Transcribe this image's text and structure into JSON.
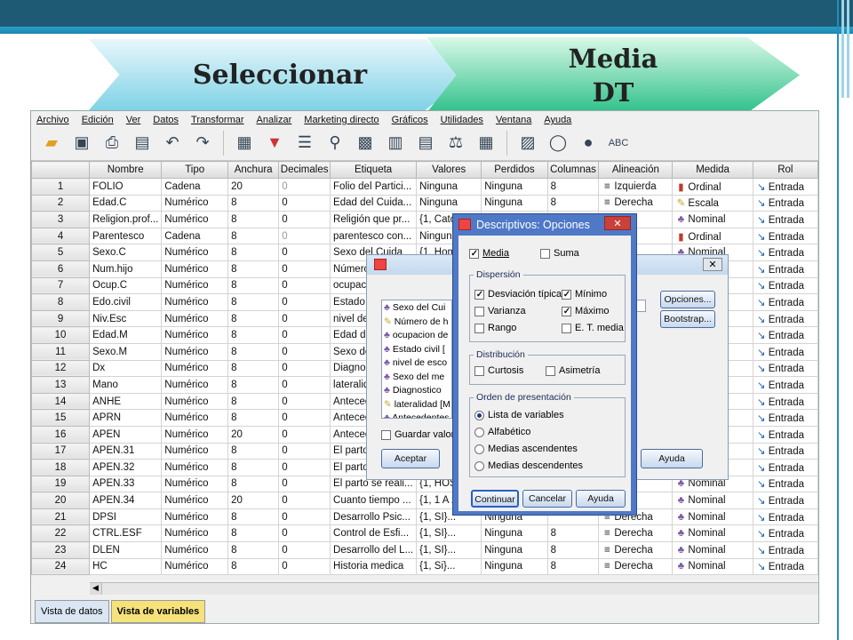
{
  "slide": {
    "step1": "Seleccionar",
    "step2_line1": "Media",
    "step2_line2": "DT"
  },
  "menu": [
    "Archivo",
    "Edición",
    "Ver",
    "Datos",
    "Transformar",
    "Analizar",
    "Marketing directo",
    "Gráficos",
    "Utilidades",
    "Ventana",
    "Ayuda"
  ],
  "grid": {
    "headers": [
      "",
      "Nombre",
      "Tipo",
      "Anchura",
      "Decimales",
      "Etiqueta",
      "Valores",
      "Perdidos",
      "Columnas",
      "Alineación",
      "Medida",
      "Rol"
    ],
    "rows": [
      [
        "1",
        "FOLIO",
        "Cadena",
        "20",
        "0",
        "Folio del Partici...",
        "Ninguna",
        "Ninguna",
        "8",
        "Izquierda",
        "Ordinal",
        "Entrada"
      ],
      [
        "2",
        "Edad.C",
        "Numérico",
        "8",
        "0",
        "Edad del Cuida...",
        "Ninguna",
        "Ninguna",
        "8",
        "Derecha",
        "Escala",
        "Entrada"
      ],
      [
        "3",
        "Religion.prof...",
        "Numérico",
        "8",
        "0",
        "Religión que pr...",
        "{1, Catolic",
        "",
        "",
        "a",
        "Nominal",
        "Entrada"
      ],
      [
        "4",
        "Parentesco",
        "Cadena",
        "8",
        "0",
        "parentesco con...",
        "Ninguna",
        "",
        "",
        "da",
        "Ordinal",
        "Entrada"
      ],
      [
        "5",
        "Sexo.C",
        "Numérico",
        "8",
        "0",
        "Sexo del Cuida",
        "{1, Homb",
        "",
        "",
        "a",
        "Nominal",
        "Entrada"
      ],
      [
        "6",
        "Num.hijo",
        "Numérico",
        "8",
        "0",
        "Número",
        "",
        "",
        "",
        "",
        "",
        "Entrada"
      ],
      [
        "7",
        "Ocup.C",
        "Numérico",
        "8",
        "0",
        "ocupacio",
        "",
        "",
        "",
        "",
        "",
        "Entrada"
      ],
      [
        "8",
        "Edo.civil",
        "Numérico",
        "8",
        "0",
        "Estado c",
        "",
        "",
        "",
        "",
        "",
        "Entrada"
      ],
      [
        "9",
        "Niv.Esc",
        "Numérico",
        "8",
        "0",
        "nivel de",
        "",
        "",
        "",
        "",
        "",
        "Entrada"
      ],
      [
        "10",
        "Edad.M",
        "Numérico",
        "8",
        "0",
        "Edad de",
        "",
        "",
        "",
        "",
        "",
        "Entrada"
      ],
      [
        "11",
        "Sexo.M",
        "Numérico",
        "8",
        "0",
        "Sexo de",
        "",
        "",
        "",
        "",
        "",
        "Entrada"
      ],
      [
        "12",
        "Dx",
        "Numérico",
        "8",
        "0",
        "Diagnost",
        "",
        "",
        "",
        "",
        "",
        "Entrada"
      ],
      [
        "13",
        "Mano",
        "Numérico",
        "8",
        "0",
        "lateralida",
        "",
        "",
        "",
        "",
        "",
        "Entrada"
      ],
      [
        "14",
        "ANHE",
        "Numérico",
        "8",
        "0",
        "Anteced",
        "",
        "",
        "",
        "",
        "",
        "Entrada"
      ],
      [
        "15",
        "APRN",
        "Numérico",
        "8",
        "0",
        "Anteced",
        "",
        "",
        "",
        "",
        "",
        "Entrada"
      ],
      [
        "16",
        "APEN",
        "Numérico",
        "20",
        "0",
        "Anteced",
        "",
        "",
        "",
        "",
        "",
        "Entrada"
      ],
      [
        "17",
        "APEN.31",
        "Numérico",
        "8",
        "0",
        "El parto",
        "",
        "",
        "",
        "",
        "",
        "Entrada"
      ],
      [
        "18",
        "APEN.32",
        "Numérico",
        "8",
        "0",
        "El parto",
        "",
        "",
        "",
        "",
        "",
        "Entrada"
      ],
      [
        "19",
        "APEN.33",
        "Numérico",
        "8",
        "0",
        "El parto se reali...",
        "{1, HOSP",
        "",
        "",
        "a",
        "Nominal",
        "Entrada"
      ],
      [
        "20",
        "APEN.34",
        "Numérico",
        "20",
        "0",
        "Cuanto tiempo ...",
        "{1, 1 A 2",
        "",
        "",
        "a",
        "Nominal",
        "Entrada"
      ],
      [
        "21",
        "DPSI",
        "Numérico",
        "8",
        "0",
        "Desarrollo Psic...",
        "{1, SI}...",
        "Ninguna",
        "",
        "Derecha",
        "Nominal",
        "Entrada"
      ],
      [
        "22",
        "CTRL.ESF",
        "Numérico",
        "8",
        "0",
        "Control de Esfi...",
        "{1, SI}...",
        "Ninguna",
        "8",
        "Derecha",
        "Nominal",
        "Entrada"
      ],
      [
        "23",
        "DLEN",
        "Numérico",
        "8",
        "0",
        "Desarrollo del L...",
        "{1, SI}...",
        "Ninguna",
        "8",
        "Derecha",
        "Nominal",
        "Entrada"
      ],
      [
        "24",
        "HC",
        "Numérico",
        "8",
        "0",
        "Historia medica",
        "{1, Si}...",
        "Ninguna",
        "8",
        "Derecha",
        "Nominal",
        "Entrada"
      ]
    ]
  },
  "tabs": {
    "data_view": "Vista de datos",
    "variable_view": "Vista de variables"
  },
  "bg_dialog": {
    "vars": [
      "Sexo del Cui",
      "Número de h",
      "ocupacion de",
      "Estado civil [",
      "nivel de esco",
      "Sexo del me",
      "Diagnostico",
      "lateralidad [M",
      "Antecedentes"
    ],
    "opciones": "Opciones...",
    "bootstrap": "Bootstrap...",
    "guardar": "Guardar valore",
    "aceptar": "Aceptar",
    "ayuda": "Ayuda"
  },
  "dialog": {
    "title": "Descriptivos: Opciones",
    "close": "✕",
    "media": "Media",
    "suma": "Suma",
    "dispersion_legend": "Dispersión",
    "desv": "Desviación típica",
    "minimo": "Mínimo",
    "varianza": "Varianza",
    "maximo": "Máximo",
    "rango": "Rango",
    "et_media": "E. T. media",
    "distribucion_legend": "Distribución",
    "curtosis": "Curtosis",
    "asimetria": "Asimetría",
    "orden_legend": "Orden de presentación",
    "lista": "Lista de variables",
    "alfabetico": "Alfabético",
    "med_asc": "Medias ascendentes",
    "med_desc": "Medias descendentes",
    "continuar": "Continuar",
    "cancelar": "Cancelar",
    "ayuda": "Ayuda"
  }
}
